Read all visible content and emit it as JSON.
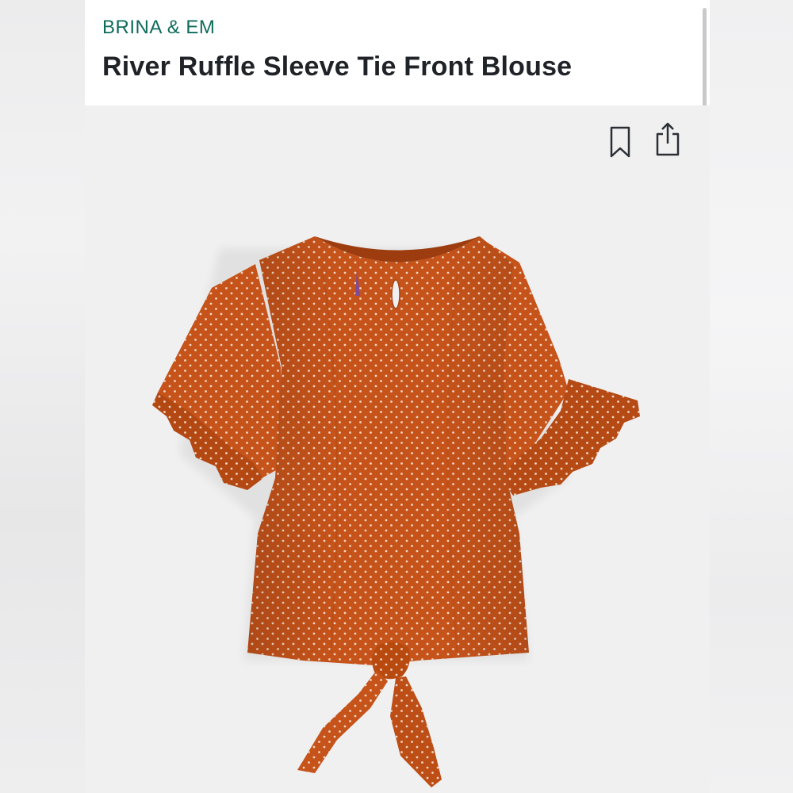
{
  "product": {
    "brand": "BRINA & EM",
    "title": "River Ruffle Sleeve Tie Front Blouse"
  },
  "actions": {
    "bookmark_icon": "bookmark-icon",
    "share_icon": "share-icon"
  },
  "colors": {
    "brand": "#0f6b5c",
    "title": "#1f2328",
    "garment": "#c5531a",
    "dots": "#f3d6c4",
    "image_bg": "#f0f0f1"
  }
}
